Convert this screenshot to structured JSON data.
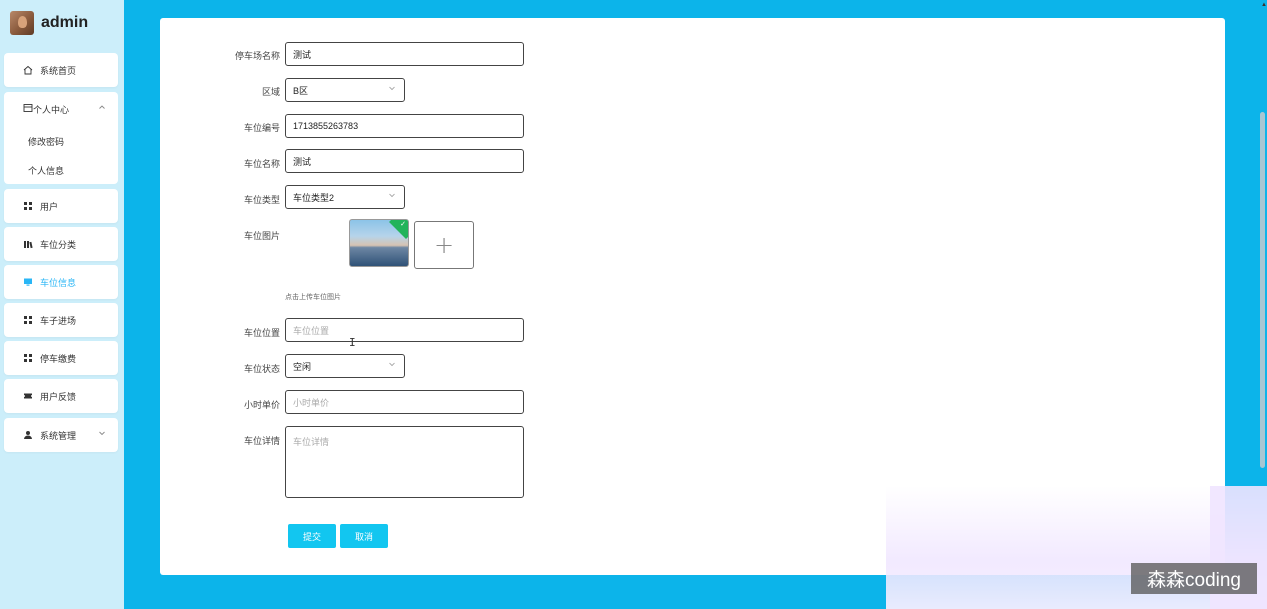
{
  "app": {
    "user_name": "admin"
  },
  "sidebar": {
    "home": "系统首页",
    "personal_center": "个人中心",
    "change_password": "修改密码",
    "personal_info": "个人信息",
    "users": "用户",
    "space_category": "车位分类",
    "space_info": "车位信息",
    "car_entry": "车子进场",
    "parking_fee": "停车缴费",
    "user_feedback": "用户反馈",
    "system_admin": "系统管理"
  },
  "form": {
    "lot_name_label": "停车场名称",
    "lot_name_value": "测试",
    "area_label": "区域",
    "area_value": "B区",
    "space_no_label": "车位编号",
    "space_no_value": "1713855263783",
    "space_name_label": "车位名称",
    "space_name_value": "测试",
    "space_type_label": "车位类型",
    "space_type_value": "车位类型2",
    "space_image_label": "车位图片",
    "upload_hint": "点击上传车位图片",
    "location_label": "车位位置",
    "location_placeholder": "车位位置",
    "status_label": "车位状态",
    "status_value": "空闲",
    "hourly_price_label": "小时单价",
    "hourly_price_placeholder": "小时单价",
    "details_label": "车位详情",
    "details_placeholder": "车位详情",
    "submit": "提交",
    "cancel": "取消"
  },
  "watermark": "森森coding",
  "colors": {
    "accent": "#12c6f0",
    "background": "#0cb4ea",
    "sidebar": "#cceefa",
    "active": "#29b6f6"
  }
}
